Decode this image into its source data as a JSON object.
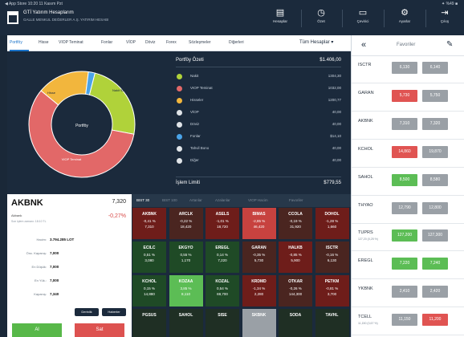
{
  "status_bar": {
    "left": "◀ App Store  10:20  11 Kasım Pzt",
    "right": "✦ %49 ■"
  },
  "header": {
    "title": "GTİ Yatırım Hesaplarım",
    "subtitle": "GALLE MENKUL DEĞERLER A.Ş. YATIRIM HESABI",
    "buttons": [
      {
        "label": "Hesaplar",
        "icon": "▤"
      },
      {
        "label": "Özet",
        "icon": "◷"
      },
      {
        "label": "Çevirici",
        "icon": "▭"
      },
      {
        "label": "Ayarlar",
        "icon": "⚙"
      },
      {
        "label": "Çıkış",
        "icon": "⇥"
      }
    ]
  },
  "tabs": [
    "Portföy",
    "Hisse",
    "VIOP Teminat",
    "Fonlar",
    "VİOP",
    "Döviz",
    "Forex",
    "Sözleşmeler",
    "Diğerleri"
  ],
  "account_select": "Tüm Hesaplar ▾",
  "portfolio": {
    "title": "Portföy Özeti",
    "total": "$1.406,00",
    "center_label": "Portföy",
    "rows": [
      {
        "name": "Nakit",
        "value": "1304,30",
        "color": "#b0d23a"
      },
      {
        "name": "VIOP Teminat",
        "value": "1032,00",
        "color": "#e26868"
      },
      {
        "name": "Hisseler",
        "value": "1200,77",
        "color": "#f2b63d"
      },
      {
        "name": "VİOP",
        "value": "40,00",
        "color": "#e0e4e8"
      },
      {
        "name": "Döviz",
        "value": "40,00",
        "color": "#e0e4e8"
      },
      {
        "name": "Fonlar",
        "value": "$14,10",
        "color": "#4aa3e8"
      },
      {
        "name": "Tahvil Bono",
        "value": "40,00",
        "color": "#e0e4e8"
      },
      {
        "name": "Diğer",
        "value": "40,00",
        "color": "#e0e4e8"
      }
    ],
    "footer_label": "İşlem Limiti",
    "footer_value": "$779,55"
  },
  "pie_labels": {
    "green": "Nakit $1.3",
    "red": "VIOP Teminat",
    "yellow": "Hisse"
  },
  "chart_data": {
    "type": "pie",
    "categories": [
      "Nakit",
      "VIOP Teminat",
      "Hisseler",
      "Fonlar"
    ],
    "values": [
      24,
      58,
      16,
      2
    ],
    "colors": [
      "#b0d23a",
      "#e26868",
      "#f2b63d",
      "#4aa3e8"
    ]
  },
  "watchlist": {
    "title": "Favoriler",
    "rows": [
      {
        "symbol": "ISCTR",
        "sub": "",
        "bid": "6,130",
        "ask": "6,140",
        "bid_color": "#9aa0a6",
        "ask_color": "#9aa0a6"
      },
      {
        "symbol": "GARAN",
        "sub": "",
        "bid": "5,730",
        "ask": "5,750",
        "bid_color": "#e05452",
        "ask_color": "#9aa0a6"
      },
      {
        "symbol": "AKBNK",
        "sub": "",
        "bid": "7,310",
        "ask": "7,320",
        "bid_color": "#9aa0a6",
        "ask_color": "#9aa0a6"
      },
      {
        "symbol": "KCHOL",
        "sub": "",
        "bid": "14,860",
        "ask": "19,870",
        "bid_color": "#e05452",
        "ask_color": "#9aa0a6"
      },
      {
        "symbol": "SAHOL",
        "sub": "",
        "bid": "8,500",
        "ask": "8,580",
        "bid_color": "#5cbd55",
        "ask_color": "#9aa0a6"
      },
      {
        "symbol": "THYAO",
        "sub": "",
        "bid": "12,790",
        "ask": "12,800",
        "bid_color": "#9aa0a6",
        "ask_color": "#9aa0a6"
      },
      {
        "symbol": "TUPRS",
        "sub": "127,20 (0,25 %)",
        "bid": "127,200",
        "ask": "127,300",
        "bid_color": "#5cbd55",
        "ask_color": "#9aa0a6"
      },
      {
        "symbol": "EREGL",
        "sub": "",
        "bid": "7,220",
        "ask": "7,240",
        "bid_color": "#5cbd55",
        "ask_color": "#5cbd55"
      },
      {
        "symbol": "YKBNK",
        "sub": "",
        "bid": "2,410",
        "ask": "2,420",
        "bid_color": "#9aa0a6",
        "ask_color": "#9aa0a6"
      },
      {
        "symbol": "TCELL",
        "sub": "11,150 (0,67 %)",
        "bid": "11,150",
        "ask": "11,200",
        "bid_color": "#9aa0a6",
        "ask_color": "#e05452"
      }
    ]
  },
  "stock": {
    "symbol": "AKBNK",
    "price": "7,320",
    "name": "Akbank",
    "change": "-0,27%",
    "time": "Son işlem zamanı: 18:10 TL",
    "fields": [
      {
        "label": "Hacim:",
        "value": "3.794.285 LOT"
      },
      {
        "label": "Önc. Kapanış:",
        "value": "7,000"
      },
      {
        "label": "En Düşük:",
        "value": "7,000"
      },
      {
        "label": "En Yük.:",
        "value": "7,000"
      },
      {
        "label": "Kapanış:",
        "value": "7,340"
      }
    ],
    "btn1": "Derinlik",
    "btn2": "Haberler",
    "buy": "Al",
    "sell": "Sat"
  },
  "heatmap": {
    "tabs": [
      "BIST 30",
      "BIST 100",
      "Artanlar",
      "Azalanlar",
      "VIOP Hacim",
      "Favoriler"
    ],
    "cells": [
      {
        "s": "AKBNK",
        "p": "-0,41 %",
        "v": "7,310",
        "c": "#6e1d1a"
      },
      {
        "s": "ARCLK",
        "p": "-0,22 %",
        "v": "18,420",
        "c": "#4a2520"
      },
      {
        "s": "ASELS",
        "p": "-1,01 %",
        "v": "18,720",
        "c": "#6e1d1a"
      },
      {
        "s": "BIMAS",
        "p": "-2,85 %",
        "v": "46,420",
        "c": "#c7423f"
      },
      {
        "s": "CCOLA",
        "p": "-0,19 %",
        "v": "31,920",
        "c": "#4a2520"
      },
      {
        "s": "DOHOL",
        "p": "-1,28 %",
        "v": "1,660",
        "c": "#6e1d1a"
      },
      {
        "s": "ECILC",
        "p": "0,51 %",
        "v": "3,080",
        "c": "#1f4a26"
      },
      {
        "s": "EKGYO",
        "p": "0,55 %",
        "v": "1,170",
        "c": "#1f4a26"
      },
      {
        "s": "EREGL",
        "p": "0,14 %",
        "v": "7,220",
        "c": "#1f4a26"
      },
      {
        "s": "GARAN",
        "p": "-0,35 %",
        "v": "5,730",
        "c": "#4a2520"
      },
      {
        "s": "HALKB",
        "p": "-0,85 %",
        "v": "5,900",
        "c": "#6e1d1a"
      },
      {
        "s": "ISCTR",
        "p": "-0,16 %",
        "v": "6,130",
        "c": "#4a2520"
      },
      {
        "s": "KCHOL",
        "p": "0,15 %",
        "v": "14,880",
        "c": "#1f4a26"
      },
      {
        "s": "KOZAA",
        "p": "3,85 %",
        "v": "8,110",
        "c": "#5cbd55"
      },
      {
        "s": "KOZAL",
        "p": "0,54 %",
        "v": "69,700",
        "c": "#1f4a26"
      },
      {
        "s": "KRDMD",
        "p": "-1,34 %",
        "v": "2,280",
        "c": "#6e1d1a"
      },
      {
        "s": "OTKAR",
        "p": "-0,26 %",
        "v": "144,300",
        "c": "#4a2520"
      },
      {
        "s": "PETKM",
        "p": "-0,81 %",
        "v": "3,700",
        "c": "#6e1d1a"
      },
      {
        "s": "PGSUS",
        "p": "",
        "v": "",
        "c": "#1f2f24"
      },
      {
        "s": "SAHOL",
        "p": "",
        "v": "",
        "c": "#1f2f24"
      },
      {
        "s": "SISE",
        "p": "",
        "v": "",
        "c": "#1f2f24"
      },
      {
        "s": "SKBNK",
        "p": "",
        "v": "",
        "c": "#9aa0a6"
      },
      {
        "s": "SODA",
        "p": "",
        "v": "",
        "c": "#1f2f24"
      },
      {
        "s": "TAVHL",
        "p": "",
        "v": "",
        "c": "#1f2f24"
      }
    ]
  }
}
